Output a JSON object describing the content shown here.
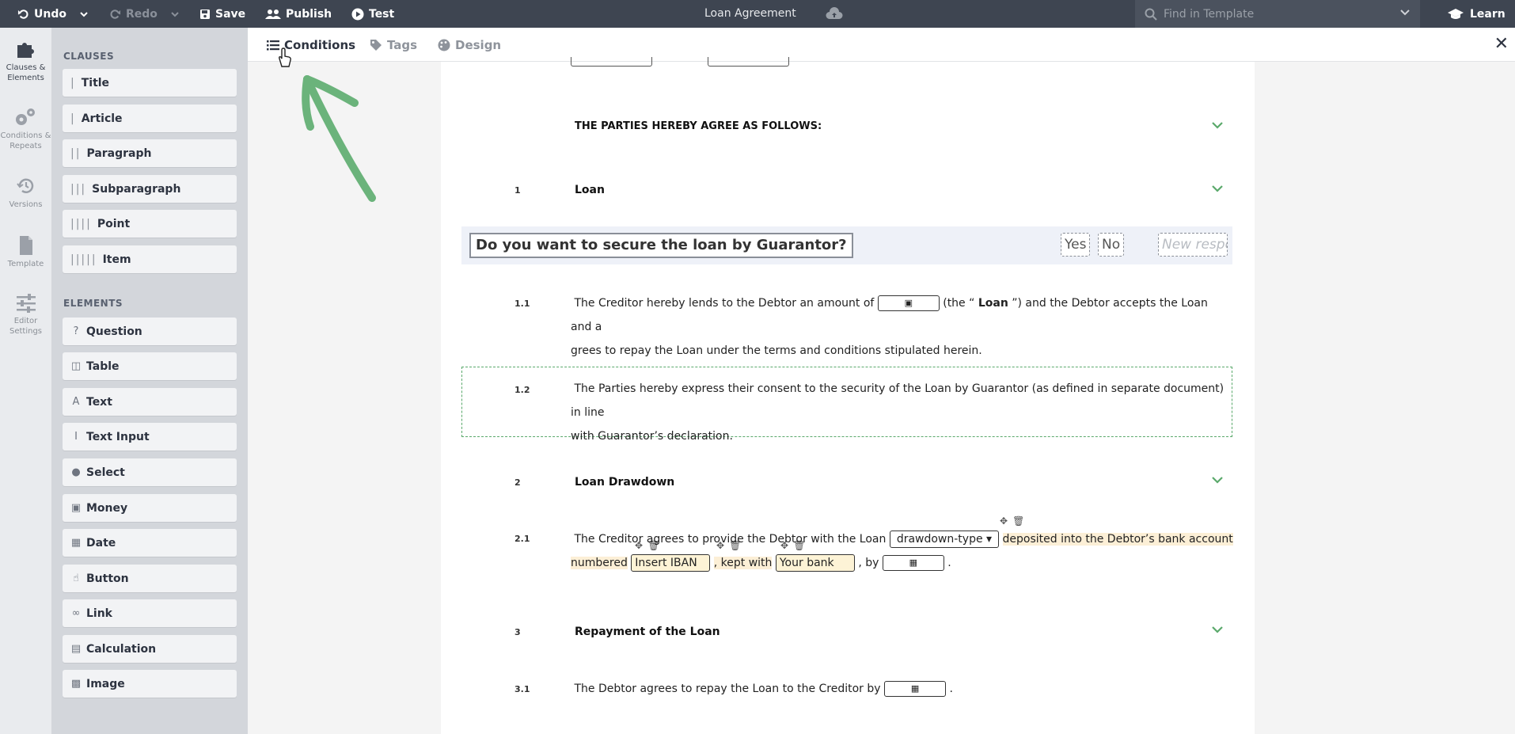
{
  "topbar": {
    "undo": "Undo",
    "redo": "Redo",
    "save": "Save",
    "publish": "Publish",
    "test": "Test",
    "doc_title": "Loan Agreement",
    "find_placeholder": "Find in Template",
    "learn": "Learn"
  },
  "rail": {
    "clauses": "Clauses & Elements",
    "conditions": "Conditions & Repeats",
    "versions": "Versions",
    "template": "Template",
    "editor": "Editor Settings"
  },
  "panel": {
    "clauses_head": "CLAUSES",
    "clauses": [
      "Title",
      "Article",
      "Paragraph",
      "Subparagraph",
      "Point",
      "Item"
    ],
    "elements_head": "ELEMENTS",
    "elements": [
      "Question",
      "Table",
      "Text",
      "Text Input",
      "Select",
      "Money",
      "Date",
      "Button",
      "Link",
      "Calculation",
      "Image"
    ]
  },
  "tabs": {
    "conditions": "Conditions",
    "tags": "Tags",
    "design": "Design"
  },
  "doc": {
    "agree": "THE PARTIES HEREBY AGREE AS FOLLOWS:",
    "s1_num": "1",
    "s1_title": "Loan",
    "question": "Do you want to secure the loan by Guarantor?",
    "yes": "Yes",
    "no": "No",
    "new_response": "New response",
    "p11_num": "1.1",
    "p11_a": "The Creditor hereby lends to the Debtor an amount of",
    "p11_b": "(the “",
    "p11_loan": "Loan",
    "p11_c": "”) and the Debtor accepts the Loan and a",
    "p11_d": "grees to repay the Loan under the terms and conditions stipulated herein.",
    "p12_num": "1.2",
    "p12_a": "The Parties hereby express their consent to the security of the Loan by Guarantor (as defined in separate document) in line",
    "p12_b": "with Guarantor’s declaration.",
    "s2_num": "2",
    "s2_title": "Loan Drawdown",
    "p21_num": "2.1",
    "p21_a": "The Creditor agrees to provide the Debtor with the Loan",
    "p21_select": "drawdown-type",
    "p21_b": "deposited into the Debtor’s bank account",
    "p21_c": "numbered",
    "p21_iban": "Insert IBAN",
    "p21_d": ", kept with",
    "p21_bank": "Your bank",
    "p21_e": ", by",
    "p21_f": ".",
    "s3_num": "3",
    "s3_title": "Repayment of the Loan",
    "p31_num": "3.1",
    "p31_a": "The Debtor agrees to repay the Loan to the Creditor by",
    "p31_b": "."
  },
  "colors": {
    "accent_green": "#5aa96b",
    "topbar": "#3e4551",
    "highlight": "#fcefd6"
  }
}
